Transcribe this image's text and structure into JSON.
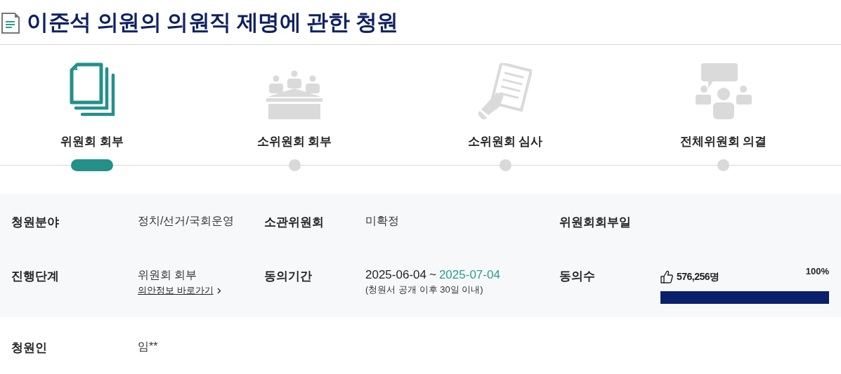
{
  "title": "이준석 의원의 의원직 제명에 관한 청원",
  "steps": [
    {
      "label": "위원회 회부",
      "kind": "documents",
      "selected": true
    },
    {
      "label": "소위원회 회부",
      "kind": "meeting",
      "selected": false
    },
    {
      "label": "소위원회 심사",
      "kind": "review",
      "selected": false
    },
    {
      "label": "전체위원회 의결",
      "kind": "discussion",
      "selected": false
    }
  ],
  "info": {
    "field": {
      "label": "청원분야",
      "value": "정치/선거/국회운영"
    },
    "committee": {
      "label": "소관위원회",
      "value": "미확정"
    },
    "referral_date": {
      "label": "위원회회부일"
    },
    "stage": {
      "label": "진행단계",
      "value": "위원회 회부",
      "link": "의안정보 바로가기"
    },
    "period": {
      "label": "동의기간",
      "start": "2025-06-04",
      "separator": "~",
      "end": "2025-07-04",
      "note": "(청원서 공개 이후 30일 이내)"
    },
    "agreements": {
      "label": "동의수",
      "count": "576,256명",
      "percent": "100%",
      "level": 1.0
    },
    "petitioner": {
      "label": "청원인",
      "value": "임**"
    }
  }
}
